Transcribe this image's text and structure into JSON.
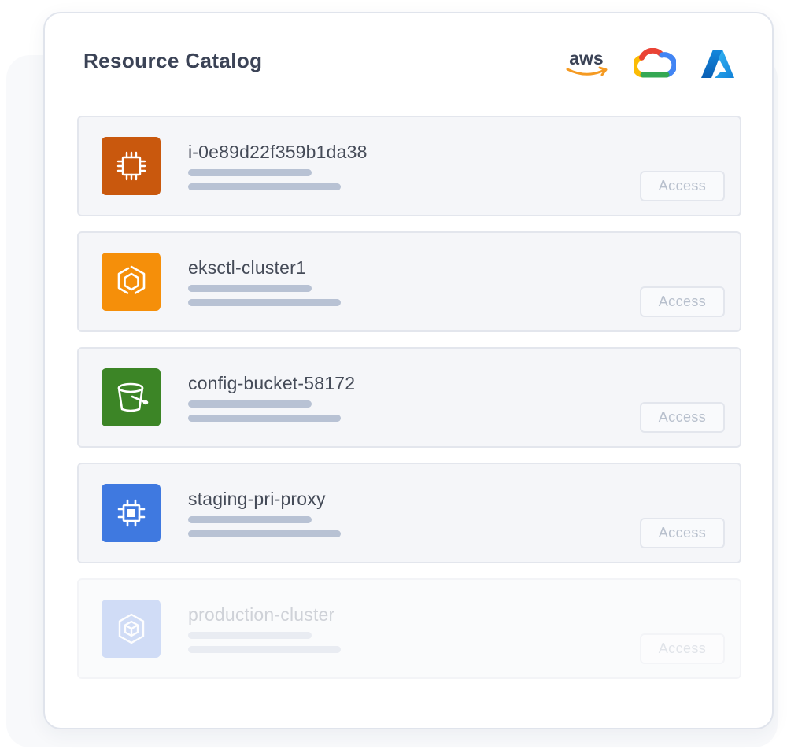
{
  "catalog": {
    "title": "Resource Catalog",
    "providers": [
      {
        "name": "aws",
        "icon": "aws-logo",
        "label": "aws"
      },
      {
        "name": "gcp",
        "icon": "google-cloud-logo"
      },
      {
        "name": "azure",
        "icon": "azure-logo"
      }
    ],
    "resources": [
      {
        "name": "i-0e89d22f359b1da38",
        "icon": "ec2-chip-icon",
        "icon_color": "#c9580d",
        "action": "Access",
        "faded": false
      },
      {
        "name": "eksctl-cluster1",
        "icon": "eks-icon",
        "icon_color": "#f58f0a",
        "action": "Access",
        "faded": false
      },
      {
        "name": "config-bucket-58172",
        "icon": "s3-bucket-icon",
        "icon_color": "#3c8526",
        "action": "Access",
        "faded": false
      },
      {
        "name": "staging-pri-proxy",
        "icon": "compute-engine-chip-icon",
        "icon_color": "#3f79e0",
        "action": "Access",
        "faded": false
      },
      {
        "name": "production-cluster",
        "icon": "gke-icon",
        "icon_color": "#6f97e5",
        "action": "Access",
        "faded": true
      }
    ]
  }
}
